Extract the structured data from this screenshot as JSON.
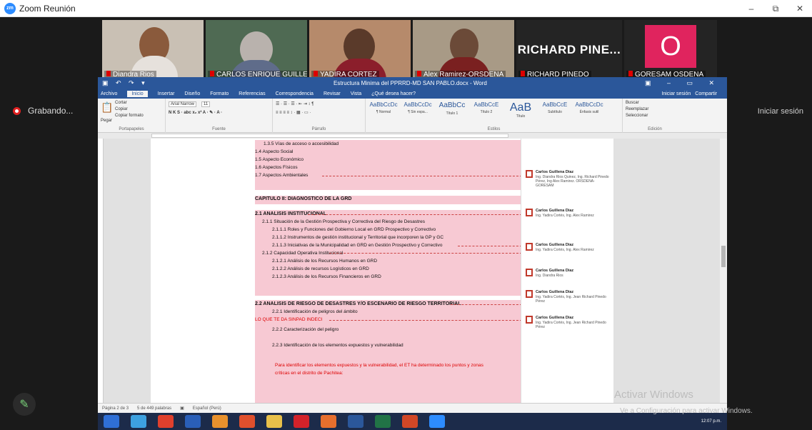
{
  "zoom": {
    "window_title": "Zoom Reunión",
    "logo": "zm",
    "controls": {
      "minimize": "–",
      "restore": "⧉",
      "close": "✕"
    },
    "recording_label": "Grabando...",
    "signin_label": "Iniciar sesión",
    "participants": [
      {
        "name": "Diandra Rios",
        "kind": "video"
      },
      {
        "name": "CARLOS ENRIQUE GUILLE...",
        "kind": "video"
      },
      {
        "name": "YADIRA CORTEZ",
        "kind": "video"
      },
      {
        "name": "Alex Ramirez-ORSDENA",
        "kind": "video"
      },
      {
        "name": "RICHARD PINEDO",
        "kind": "text",
        "display": "RICHARD  PINE..."
      },
      {
        "name": "GORESAM OSDENA",
        "kind": "avatar",
        "display": "O",
        "color": "#e0245e"
      }
    ],
    "icons": {
      "pencil": "pencil-icon",
      "record": "record-icon"
    }
  },
  "word": {
    "doc_title": "Estructura Minima del PPRRD-MD SAN PABLO.docx - Word",
    "tabs": [
      "Archivo",
      "Inicio",
      "Insertar",
      "Diseño",
      "Formato",
      "Referencias",
      "Correspondencia",
      "Revisar",
      "Vista",
      "¿Qué desea hacer?"
    ],
    "tabs_right": [
      "Iniciar sesión",
      "Compartir"
    ],
    "ribbon": {
      "clipboard": {
        "paste": "Pegar",
        "cut": "Cortar",
        "copy": "Copiar",
        "format": "Copiar formato",
        "label": "Portapapeles"
      },
      "font": {
        "name": "Arial Narrow",
        "size": "11",
        "label": "Fuente"
      },
      "paragraph_label": "Párrafo",
      "styles": [
        {
          "sample": "AaBbCcDc",
          "caption": "¶ Normal"
        },
        {
          "sample": "AaBbCcDc",
          "caption": "¶ Sin espa..."
        },
        {
          "sample": "AaBbCc",
          "caption": "Título 1"
        },
        {
          "sample": "AaBbCcE",
          "caption": "Título 2"
        },
        {
          "sample": "AaB",
          "caption": "Título"
        },
        {
          "sample": "AaBbCcE",
          "caption": "Subtítulo"
        },
        {
          "sample": "AaBbCcDc",
          "caption": "Énfasis sutil"
        }
      ],
      "styles_label": "Estilos",
      "editing": {
        "find": "Buscar",
        "replace": "Reemplazar",
        "select": "Seleccionar",
        "label": "Edición"
      }
    },
    "lines": [
      {
        "text": "1.3.5  Vías de acceso o accesibilidad",
        "bold": false
      },
      {
        "text": "1.4 Aspecto Social",
        "bold": false
      },
      {
        "text": "1.5 Aspecto Económico",
        "bold": false
      },
      {
        "text": "1.6 Aspectos Físicos",
        "bold": false
      },
      {
        "text": "1.7 Aspectos Ambientales",
        "bold": false
      },
      {
        "text": "CAPITULO II: DIAGNOSTICO DE LA GRD",
        "bold": true
      },
      {
        "text": "2.1 ANALISIS INSTITUCIONAL",
        "bold": true
      },
      {
        "text": "2.1.1 Situación de la Gestión Prospectiva y Correctiva del Riesgo de Desastres",
        "bold": false
      },
      {
        "text": "2.1.1.1 Roles y Funciones del Gobierno Local en GRD Prospectivo y Correctivo",
        "bold": false
      },
      {
        "text": "2.1.1.2 Instrumentos de gestión institucional y Territorial que incorporen la GP y GC",
        "bold": false
      },
      {
        "text": "2.1.1.3 Iniciativas de la Municipalidad en GRD en Gestión Prospectivo y Correctivo",
        "bold": false
      },
      {
        "text": "2.1.2 Capacidad Operativa Institucional",
        "bold": false
      },
      {
        "text": "2.1.2.1 Análisis de los Recursos Humanos en GRD",
        "bold": false
      },
      {
        "text": "2.1.2.2 Análisis de recursos Logísticos en GRD",
        "bold": false
      },
      {
        "text": "2.1.2.3 Análisis de los Recursos Financieros en GRD",
        "bold": false
      },
      {
        "text": "2.2 ANALISIS DE RIESGO DE DESASTRES Y/O ESCENARIO DE RIESGO TERRITORIAL",
        "bold": true
      },
      {
        "text": "2.2.1 Identificación de peligros del ámbito",
        "bold": false
      },
      {
        "text": "LO QUE TE DA SINPAD INDECI",
        "bold": false,
        "red": true
      },
      {
        "text": "2.2.2 Caracterización del peligro",
        "bold": false
      },
      {
        "text": "2.2.3 Identificación de los elementos expuestos y vulnerabilidad",
        "bold": false
      },
      {
        "text": "Para identificar los elementos expuestos y la vulnerabilidad, el ET ha determinado los puntos y zonas",
        "bold": false,
        "red": true
      },
      {
        "text": "críticas en el distrito de Pachitea:",
        "bold": false,
        "red": true
      }
    ],
    "comments": [
      {
        "author": "Carlos Guillena Diaz",
        "text": "Ing. Diandra Rios Quinez, Ing. Richard Pinedo Pérez, Ing Alex Ramirez. ORSDENA-GORESAM"
      },
      {
        "author": "Carlos Guillena Diaz",
        "text": "Ing. Yadira Cortés, Ing. Alex Ramirez"
      },
      {
        "author": "Carlos Guillena Diaz",
        "text": "Ing. Yadira Cortés, Ing. Alex Ramirez"
      },
      {
        "author": "Carlos Guillena Diaz",
        "text": "Ing. Diandra Rios"
      },
      {
        "author": "Carlos Guillena Diaz",
        "text": "Ing. Yadira Cortés, Ing. Jean Richard Pinedo Pérez"
      },
      {
        "author": "Carlos Guillena Diaz",
        "text": "Ing. Yadira Cortés, Ing. Jean Richard Pinedo Pérez"
      }
    ],
    "status": {
      "page": "Página 2 de 3",
      "words": "5 de 449 palabras",
      "lang": "Español (Perú)"
    }
  },
  "watermark": {
    "line1": "Activar Windows",
    "line2": "Ve a Configuración para activar Windows."
  },
  "taskbar": {
    "time": "12:07 p.m."
  }
}
